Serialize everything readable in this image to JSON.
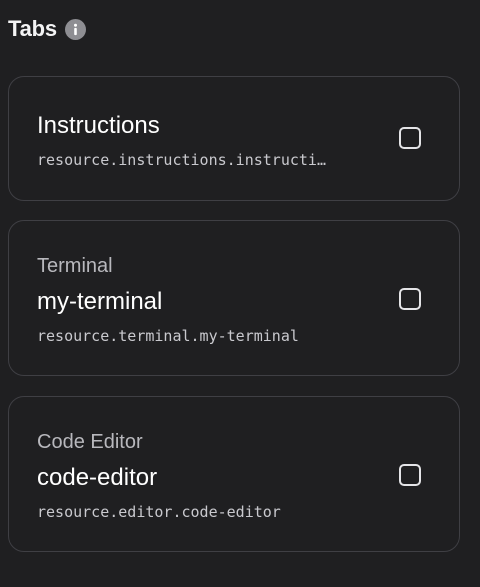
{
  "section": {
    "title": "Tabs",
    "info_icon": "info-icon"
  },
  "tabs": [
    {
      "type": "",
      "name": "Instructions",
      "resource": "resource.instructions.instructi…",
      "checked": false
    },
    {
      "type": "Terminal",
      "name": "my-terminal",
      "resource": "resource.terminal.my-terminal",
      "checked": false
    },
    {
      "type": "Code Editor",
      "name": "code-editor",
      "resource": "resource.editor.code-editor",
      "checked": false
    }
  ],
  "colors": {
    "background": "#1f1f21",
    "card_border": "#3f3f44",
    "text_primary": "#ffffff",
    "text_secondary": "#b8b8bd",
    "info_icon_bg": "#8e8e93"
  }
}
